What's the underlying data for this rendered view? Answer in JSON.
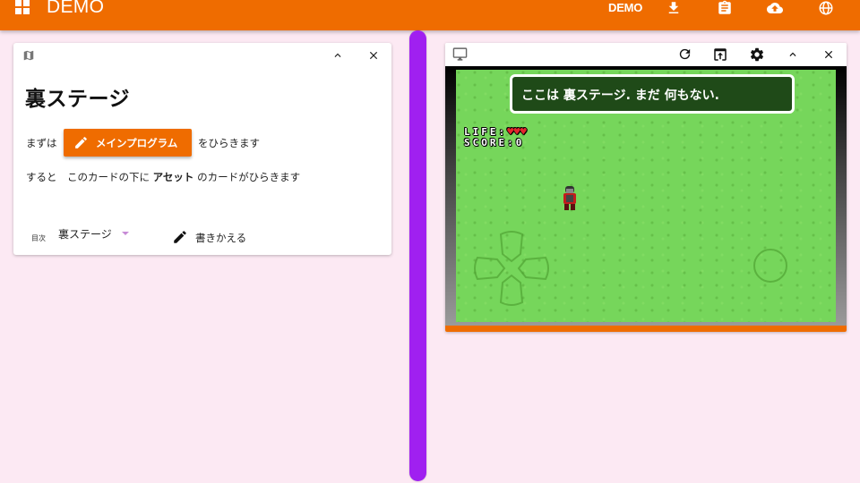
{
  "app": {
    "title": "DEMO",
    "user": "DEMO",
    "accent": "#ef6c00",
    "toolbar_icons": [
      "download-icon",
      "clipboard-icon",
      "cloud-upload-icon",
      "globe-icon"
    ]
  },
  "left_card": {
    "header_icons": [
      "map-icon",
      "collapse-icon",
      "close-icon"
    ],
    "title": "裏ステージ",
    "line1_prefix": "まずは",
    "main_button": "メインプログラム",
    "line1_suffix": "をひらきます",
    "line2_a": "すると　このカードの下に",
    "line2_bold": "アセット",
    "line2_c": "のカードがひらきます",
    "toc_label": "目次",
    "toc_value": "裏ステージ",
    "rewrite_label": "書きかえる"
  },
  "divider": {
    "color": "#a020f0"
  },
  "game_card": {
    "toolbar_icons": [
      "monitor-icon",
      "reload-icon",
      "open-in-new-icon",
      "settings-icon",
      "collapse-icon",
      "close-icon"
    ],
    "message": "ここは 裏ステージ. まだ 何もない.",
    "hud": {
      "life_label": "LIFE:",
      "life_hearts": "♥♥♥",
      "score_label": "SCORE:",
      "score_value": "0"
    },
    "grass_color": "#76d65b"
  }
}
